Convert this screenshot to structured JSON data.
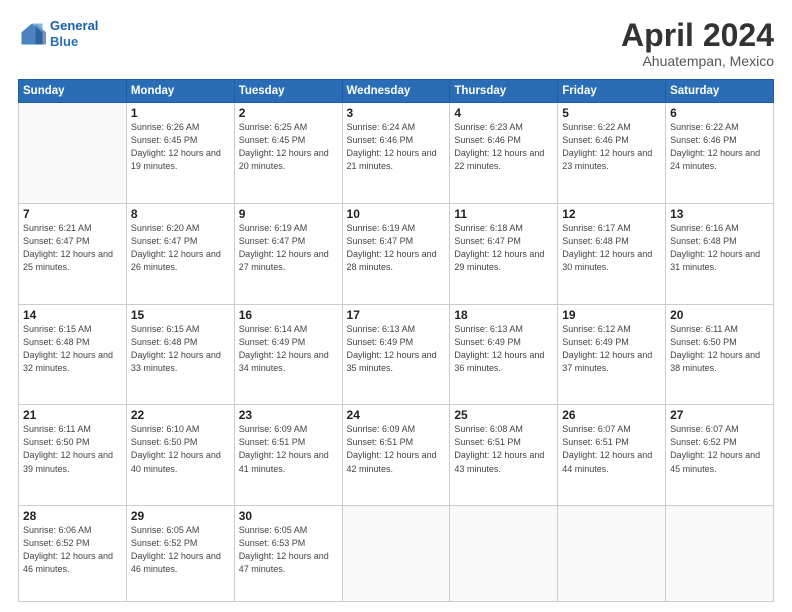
{
  "header": {
    "logo_line1": "General",
    "logo_line2": "Blue",
    "month": "April 2024",
    "location": "Ahuatempan, Mexico"
  },
  "weekdays": [
    "Sunday",
    "Monday",
    "Tuesday",
    "Wednesday",
    "Thursday",
    "Friday",
    "Saturday"
  ],
  "weeks": [
    [
      {
        "day": "",
        "sunrise": "",
        "sunset": "",
        "daylight": ""
      },
      {
        "day": "1",
        "sunrise": "Sunrise: 6:26 AM",
        "sunset": "Sunset: 6:45 PM",
        "daylight": "Daylight: 12 hours and 19 minutes."
      },
      {
        "day": "2",
        "sunrise": "Sunrise: 6:25 AM",
        "sunset": "Sunset: 6:45 PM",
        "daylight": "Daylight: 12 hours and 20 minutes."
      },
      {
        "day": "3",
        "sunrise": "Sunrise: 6:24 AM",
        "sunset": "Sunset: 6:46 PM",
        "daylight": "Daylight: 12 hours and 21 minutes."
      },
      {
        "day": "4",
        "sunrise": "Sunrise: 6:23 AM",
        "sunset": "Sunset: 6:46 PM",
        "daylight": "Daylight: 12 hours and 22 minutes."
      },
      {
        "day": "5",
        "sunrise": "Sunrise: 6:22 AM",
        "sunset": "Sunset: 6:46 PM",
        "daylight": "Daylight: 12 hours and 23 minutes."
      },
      {
        "day": "6",
        "sunrise": "Sunrise: 6:22 AM",
        "sunset": "Sunset: 6:46 PM",
        "daylight": "Daylight: 12 hours and 24 minutes."
      }
    ],
    [
      {
        "day": "7",
        "sunrise": "Sunrise: 6:21 AM",
        "sunset": "Sunset: 6:47 PM",
        "daylight": "Daylight: 12 hours and 25 minutes."
      },
      {
        "day": "8",
        "sunrise": "Sunrise: 6:20 AM",
        "sunset": "Sunset: 6:47 PM",
        "daylight": "Daylight: 12 hours and 26 minutes."
      },
      {
        "day": "9",
        "sunrise": "Sunrise: 6:19 AM",
        "sunset": "Sunset: 6:47 PM",
        "daylight": "Daylight: 12 hours and 27 minutes."
      },
      {
        "day": "10",
        "sunrise": "Sunrise: 6:19 AM",
        "sunset": "Sunset: 6:47 PM",
        "daylight": "Daylight: 12 hours and 28 minutes."
      },
      {
        "day": "11",
        "sunrise": "Sunrise: 6:18 AM",
        "sunset": "Sunset: 6:47 PM",
        "daylight": "Daylight: 12 hours and 29 minutes."
      },
      {
        "day": "12",
        "sunrise": "Sunrise: 6:17 AM",
        "sunset": "Sunset: 6:48 PM",
        "daylight": "Daylight: 12 hours and 30 minutes."
      },
      {
        "day": "13",
        "sunrise": "Sunrise: 6:16 AM",
        "sunset": "Sunset: 6:48 PM",
        "daylight": "Daylight: 12 hours and 31 minutes."
      }
    ],
    [
      {
        "day": "14",
        "sunrise": "Sunrise: 6:15 AM",
        "sunset": "Sunset: 6:48 PM",
        "daylight": "Daylight: 12 hours and 32 minutes."
      },
      {
        "day": "15",
        "sunrise": "Sunrise: 6:15 AM",
        "sunset": "Sunset: 6:48 PM",
        "daylight": "Daylight: 12 hours and 33 minutes."
      },
      {
        "day": "16",
        "sunrise": "Sunrise: 6:14 AM",
        "sunset": "Sunset: 6:49 PM",
        "daylight": "Daylight: 12 hours and 34 minutes."
      },
      {
        "day": "17",
        "sunrise": "Sunrise: 6:13 AM",
        "sunset": "Sunset: 6:49 PM",
        "daylight": "Daylight: 12 hours and 35 minutes."
      },
      {
        "day": "18",
        "sunrise": "Sunrise: 6:13 AM",
        "sunset": "Sunset: 6:49 PM",
        "daylight": "Daylight: 12 hours and 36 minutes."
      },
      {
        "day": "19",
        "sunrise": "Sunrise: 6:12 AM",
        "sunset": "Sunset: 6:49 PM",
        "daylight": "Daylight: 12 hours and 37 minutes."
      },
      {
        "day": "20",
        "sunrise": "Sunrise: 6:11 AM",
        "sunset": "Sunset: 6:50 PM",
        "daylight": "Daylight: 12 hours and 38 minutes."
      }
    ],
    [
      {
        "day": "21",
        "sunrise": "Sunrise: 6:11 AM",
        "sunset": "Sunset: 6:50 PM",
        "daylight": "Daylight: 12 hours and 39 minutes."
      },
      {
        "day": "22",
        "sunrise": "Sunrise: 6:10 AM",
        "sunset": "Sunset: 6:50 PM",
        "daylight": "Daylight: 12 hours and 40 minutes."
      },
      {
        "day": "23",
        "sunrise": "Sunrise: 6:09 AM",
        "sunset": "Sunset: 6:51 PM",
        "daylight": "Daylight: 12 hours and 41 minutes."
      },
      {
        "day": "24",
        "sunrise": "Sunrise: 6:09 AM",
        "sunset": "Sunset: 6:51 PM",
        "daylight": "Daylight: 12 hours and 42 minutes."
      },
      {
        "day": "25",
        "sunrise": "Sunrise: 6:08 AM",
        "sunset": "Sunset: 6:51 PM",
        "daylight": "Daylight: 12 hours and 43 minutes."
      },
      {
        "day": "26",
        "sunrise": "Sunrise: 6:07 AM",
        "sunset": "Sunset: 6:51 PM",
        "daylight": "Daylight: 12 hours and 44 minutes."
      },
      {
        "day": "27",
        "sunrise": "Sunrise: 6:07 AM",
        "sunset": "Sunset: 6:52 PM",
        "daylight": "Daylight: 12 hours and 45 minutes."
      }
    ],
    [
      {
        "day": "28",
        "sunrise": "Sunrise: 6:06 AM",
        "sunset": "Sunset: 6:52 PM",
        "daylight": "Daylight: 12 hours and 46 minutes."
      },
      {
        "day": "29",
        "sunrise": "Sunrise: 6:05 AM",
        "sunset": "Sunset: 6:52 PM",
        "daylight": "Daylight: 12 hours and 46 minutes."
      },
      {
        "day": "30",
        "sunrise": "Sunrise: 6:05 AM",
        "sunset": "Sunset: 6:53 PM",
        "daylight": "Daylight: 12 hours and 47 minutes."
      },
      {
        "day": "",
        "sunrise": "",
        "sunset": "",
        "daylight": ""
      },
      {
        "day": "",
        "sunrise": "",
        "sunset": "",
        "daylight": ""
      },
      {
        "day": "",
        "sunrise": "",
        "sunset": "",
        "daylight": ""
      },
      {
        "day": "",
        "sunrise": "",
        "sunset": "",
        "daylight": ""
      }
    ]
  ]
}
